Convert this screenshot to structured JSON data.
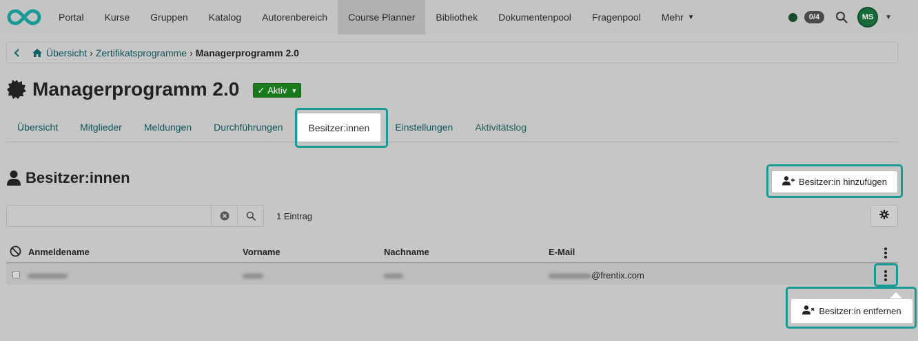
{
  "nav": {
    "items": [
      "Portal",
      "Kurse",
      "Gruppen",
      "Katalog",
      "Autorenbereich",
      "Course Planner",
      "Bibliothek",
      "Dokumentenpool",
      "Fragenpool",
      "Mehr"
    ],
    "active_index": 5,
    "badge": "0/4",
    "avatar_initials": "MS",
    "accent": "#1a9a96"
  },
  "breadcrumb": {
    "home": "Übersicht",
    "parent": "Zertifikatsprogramme",
    "current": "Managerprogramm 2.0"
  },
  "header": {
    "title": "Managerprogramm 2.0",
    "status": "Aktiv",
    "status_color": "#1b7a1b"
  },
  "tabs": [
    "Übersicht",
    "Mitglieder",
    "Meldungen",
    "Durchführungen",
    "Besitzer:innen",
    "Einstellungen",
    "Aktivitätslog"
  ],
  "section": {
    "title": "Besitzer:innen",
    "add_button": "Besitzer:in hinzufügen",
    "count": "1 Eintrag"
  },
  "table": {
    "columns": [
      "Anmeldename",
      "Vorname",
      "Nachname",
      "E-Mail"
    ],
    "rows": [
      {
        "email_domain": "@frentix.com"
      }
    ]
  },
  "popover": {
    "label": "Besitzer:in entfernen"
  }
}
